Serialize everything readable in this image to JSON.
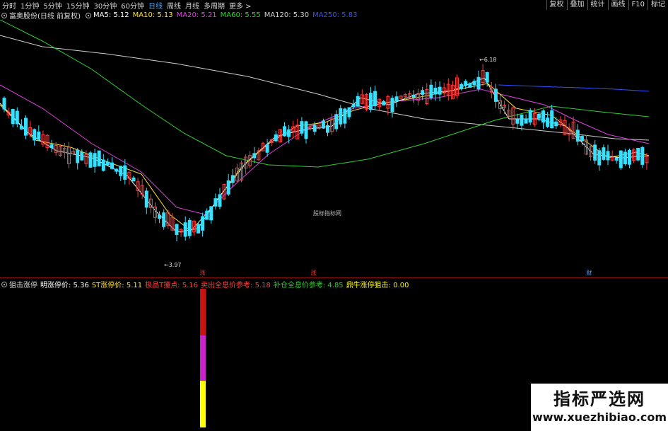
{
  "toolbar": {
    "timeframes": [
      "分时",
      "1分钟",
      "5分钟",
      "15分钟",
      "30分钟",
      "60分钟",
      "日线",
      "周线",
      "月线",
      "多周期",
      "更多 >"
    ],
    "active_index": 6,
    "right_buttons": [
      "复权",
      "叠加",
      "统计",
      "画线",
      "F10",
      "标记"
    ]
  },
  "main_legend": {
    "stock": "富奥股份(日线 前复权)",
    "ma": [
      {
        "label": "MA5: 5.12",
        "color": "#ffffff"
      },
      {
        "label": "MA10: 5.13",
        "color": "#ffe23d"
      },
      {
        "label": "MA20: 5.21",
        "color": "#e040e0"
      },
      {
        "label": "MA60: 5.55",
        "color": "#30d030"
      },
      {
        "label": "MA120: 5.30",
        "color": "#cfcfcf"
      },
      {
        "label": "MA250: 5.83",
        "color": "#3050ff"
      }
    ]
  },
  "chart": {
    "price_high": 6.18,
    "price_low": 3.97,
    "watermark": "股标指标网",
    "badges": [
      {
        "text": "涨",
        "color": "#ff3b3b"
      },
      {
        "text": "涨",
        "color": "#ff3b3b"
      },
      {
        "text": "财",
        "color": "#4aa0ff"
      }
    ]
  },
  "indicator_legend": {
    "name": "狙击涨停",
    "items": [
      {
        "label": "明涨停价: 5.36",
        "color": "#ffffff"
      },
      {
        "label": "ST涨停价: 5.11",
        "color": "#ffe23d"
      },
      {
        "label": "极品T撞点: 5.16",
        "color": "#ff4040"
      },
      {
        "label": "卖出全息价参考: 5.18",
        "color": "#ff4040"
      },
      {
        "label": "补仓全息价参考: 4.85",
        "color": "#30d030"
      },
      {
        "label": "鼎牛涨停狙击: 0.00",
        "color": "#ffff00"
      }
    ]
  },
  "brand": {
    "title": "指标严选网",
    "url": "www.xuezhibiao.com"
  },
  "colors": {
    "up": "#ff3b3b",
    "down": "#38e0ff",
    "bar_red": "#cc1111",
    "bar_magenta": "#cc22cc",
    "bar_yellow": "#ffff00"
  }
}
